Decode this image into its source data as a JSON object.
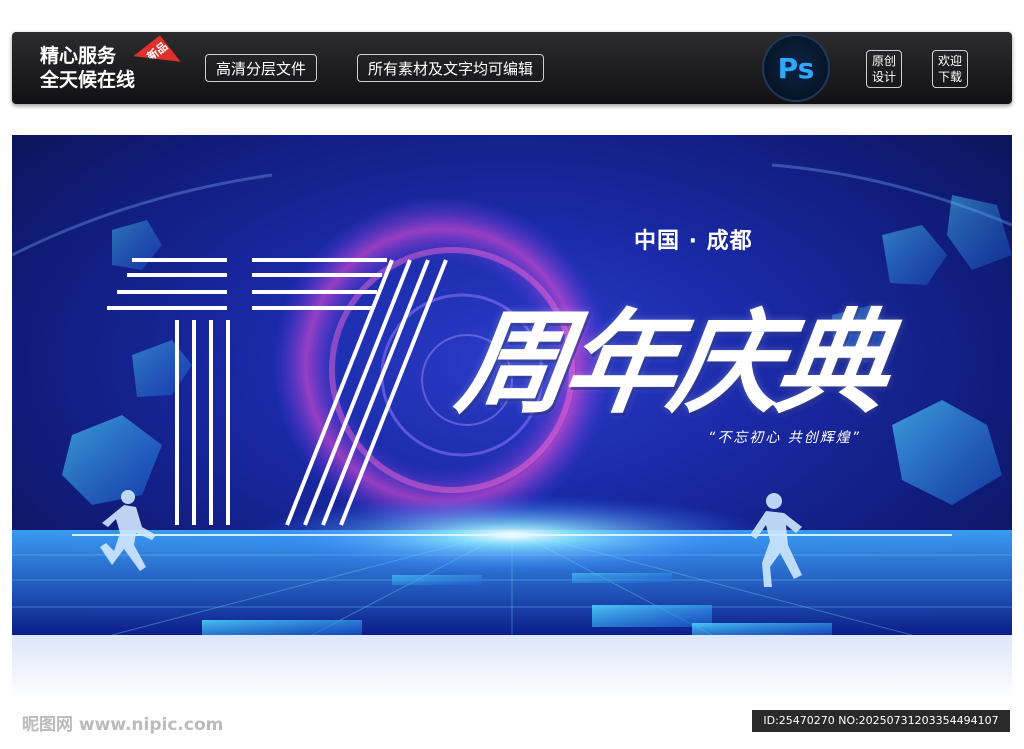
{
  "header": {
    "service_line1": "精心服务",
    "service_line2": "全天候在线",
    "badge": "新品",
    "tag1": "高清分层文件",
    "tag2": "所有素材及文字均可编辑",
    "ps_label": "Ps",
    "original_line1": "原创",
    "original_line2": "设计",
    "download_line1": "欢迎",
    "download_line2": "下载"
  },
  "poster": {
    "number": "17",
    "city": "中国 · 成都",
    "title": "周年庆典",
    "slogan": "“不忘初心 共创辉煌”"
  },
  "footer": {
    "logo": "昵图网 www.nipic.com",
    "id_text": "ID:25470270 NO:20250731203354494107"
  },
  "colors": {
    "poster_blue": "#1a2aa8",
    "accent_cyan": "#3fd0ff",
    "ps_blue": "#31a8ff",
    "badge_red": "#e0302c"
  }
}
